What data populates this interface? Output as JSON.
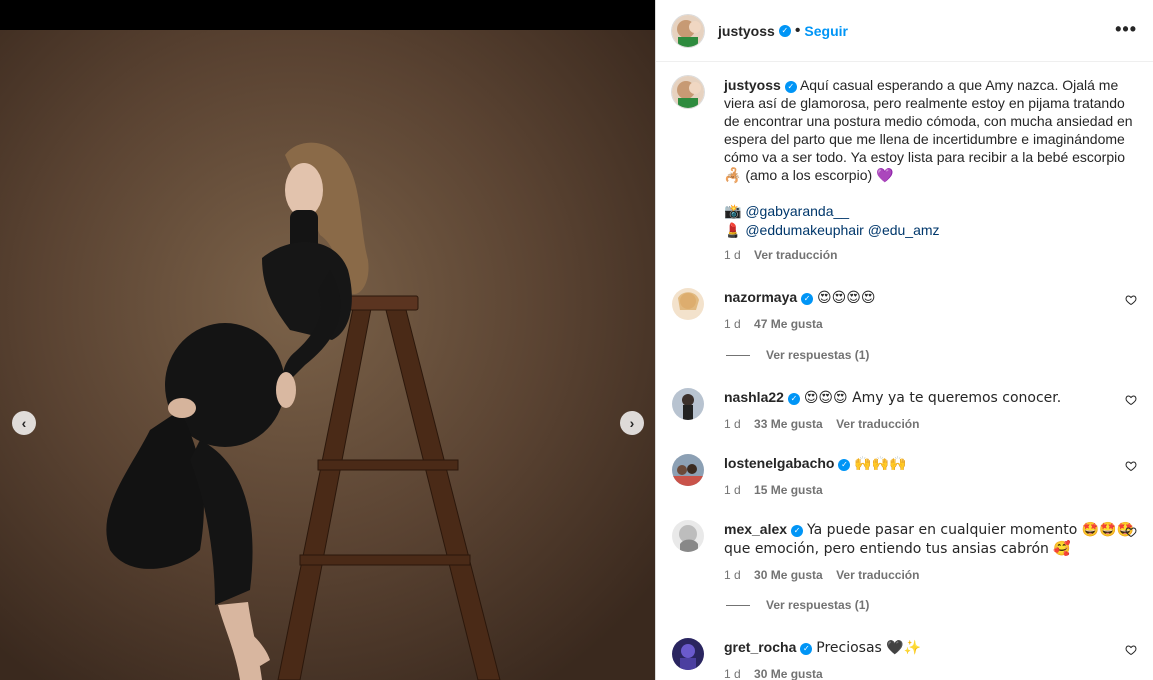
{
  "header": {
    "username": "justyoss",
    "follow": "Seguir",
    "more": "•••"
  },
  "caption": {
    "username": "justyoss",
    "text": "Aquí casual esperando a que Amy nazca. Ojalá me viera así de glamorosa, pero realmente estoy en pijama tratando de encontrar una postura medio cómoda, con mucha ansiedad en espera del parto que me llena de incertidumbre e imaginándome cómo va a ser todo. Ya estoy lista para recibir a la bebé escorpio 🦂 (amo a los escorpio) 💜",
    "credit_photo_emoji": "📸",
    "credit_photo": "@gabyaranda__",
    "credit_makeup_emoji": "💄",
    "credit_makeup_1": "@eddumakeuphair",
    "credit_makeup_2": "@edu_amz",
    "time": "1 d",
    "translate": "Ver traducción"
  },
  "comments": [
    {
      "username": "nazormaya",
      "text": "😍😍😍😍",
      "time": "1 d",
      "likes": "47 Me gusta",
      "translate": "",
      "replies": "Ver respuestas (1)"
    },
    {
      "username": "nashla22",
      "text": "😍😍😍 Amy ya te queremos conocer.",
      "time": "1 d",
      "likes": "33 Me gusta",
      "translate": "Ver traducción",
      "replies": ""
    },
    {
      "username": "lostenelgabacho",
      "text": "🙌🙌🙌",
      "time": "1 d",
      "likes": "15 Me gusta",
      "translate": "",
      "replies": ""
    },
    {
      "username": "mex_alex",
      "text": "Ya puede pasar en cualquier momento 🤩🤩🤩 que emoción, pero entiendo tus ansias cabrón 🥰",
      "time": "1 d",
      "likes": "30 Me gusta",
      "translate": "Ver traducción",
      "replies": "Ver respuestas (1)"
    },
    {
      "username": "gret_rocha",
      "text": "Preciosas 🖤✨",
      "time": "1 d",
      "likes": "30 Me gusta",
      "translate": "",
      "replies": ""
    }
  ],
  "nav": {
    "prev": "‹",
    "next": "›"
  },
  "colors": {
    "accent": "#0095f6",
    "mention": "#00376b",
    "muted": "#737373"
  }
}
